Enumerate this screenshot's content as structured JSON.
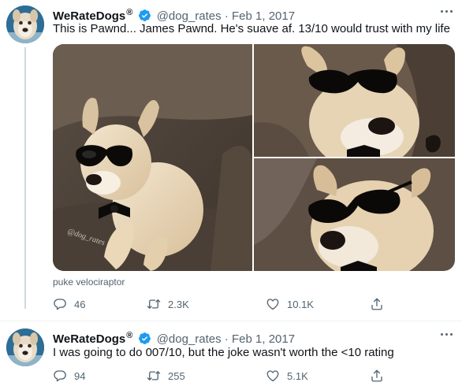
{
  "colors": {
    "verified": "#1d9bf0",
    "text_primary": "#0f1419",
    "text_secondary": "#536471",
    "divider": "#eff3f4"
  },
  "tweets": [
    {
      "name": "WeRateDogs",
      "reg_mark": "®",
      "verified_icon": "verified-badge-icon",
      "handle": "@dog_rates",
      "separator": "·",
      "date": "Feb 1, 2017",
      "text": "This is Pawnd... James Pawnd. He's suave af. 13/10 would trust with my life",
      "photo_watermark": "@dog_rates",
      "media_credit": "puke velociraptor",
      "stats": {
        "replies": "46",
        "retweets": "2.3K",
        "likes": "10.1K"
      }
    },
    {
      "name": "WeRateDogs",
      "reg_mark": "®",
      "verified_icon": "verified-badge-icon",
      "handle": "@dog_rates",
      "separator": "·",
      "date": "Feb 1, 2017",
      "text": "I was going to do 007/10, but the joke wasn't worth the <10 rating",
      "stats": {
        "replies": "94",
        "retweets": "255",
        "likes": "5.1K"
      }
    }
  ]
}
